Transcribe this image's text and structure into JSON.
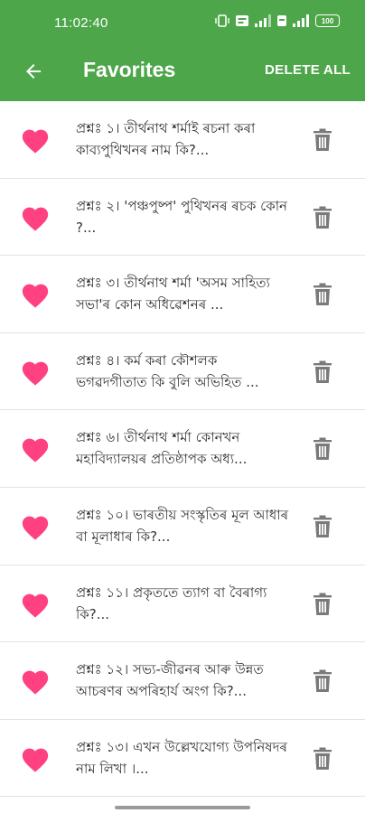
{
  "status_bar": {
    "time": "11:02:40",
    "icons": [
      "vibrate-icon",
      "volte-icon",
      "signal-icon",
      "volte-icon-2",
      "signal-icon-2",
      "battery-icon"
    ],
    "battery": "100"
  },
  "app_bar": {
    "back_icon": "arrow-left-icon",
    "title": "Favorites",
    "delete_all": "DELETE ALL",
    "color": "#4ea64a"
  },
  "items": [
    {
      "text": "প্ৰশ্নঃ ১। তীৰ্থনাথ শৰ্মাই ৰচনা কৰা কাব্যপুথিখনৰ নাম কি?..."
    },
    {
      "text": "প্ৰশ্নঃ ২। 'পঞ্চপুষ্প' পুথিখনৰ ৰচক কোন ?..."
    },
    {
      "text": "প্ৰশ্নঃ ৩। তীৰ্থনাথ শৰ্মা 'অসম সাহিত্য সভা'ৰ কোন অধিৱেশনৰ ..."
    },
    {
      "text": "প্ৰশ্নঃ ৪। কৰ্ম কৰা কৌশলক ভগৱদগীতাত কি বুলি অভিহিত ..."
    },
    {
      "text": "প্ৰশ্নঃ ৬। তীৰ্থনাথ শৰ্মা কোনখন মহাবিদ্যালয়ৰ প্ৰতিষ্ঠাপক অধ্য..."
    },
    {
      "text": "প্ৰশ্নঃ ১০। ভাৰতীয় সংস্কৃতিৰ মূল আধাৰ বা মূলাধাৰ কি?..."
    },
    {
      "text": "প্ৰশ্নঃ ১১। প্ৰকৃততে ত্যাগ বা বৈৰাগ্য কি?..."
    },
    {
      "text": "প্ৰশ্নঃ ১২। সভ্য-জীৱনৰ আৰু উন্নত আচৰণৰ অপৰিহাৰ্য অংগ কি?..."
    },
    {
      "text": "প্ৰশ্নঃ ১৩। এখন উল্লেখযোগ্য উপনিষদৰ নাম লিখা ।..."
    }
  ],
  "icons": {
    "heart": "heart-icon",
    "trash": "trash-icon"
  },
  "colors": {
    "heart": "#ff4081",
    "trash": "#7a7a7a",
    "divider": "#e3e3e3"
  }
}
